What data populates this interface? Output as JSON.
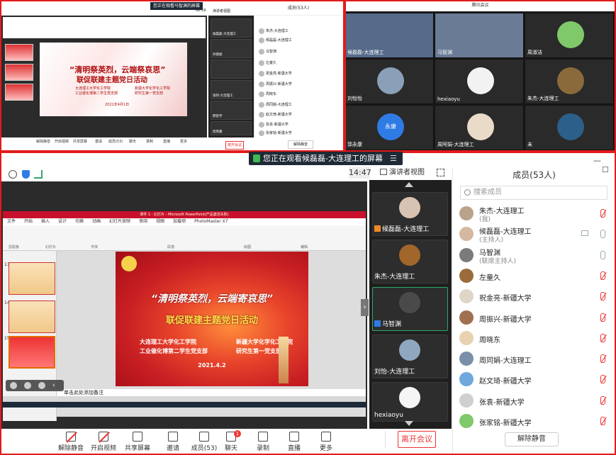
{
  "thumb": {
    "notice": "您正在观看马智渊的屏幕",
    "time": "00:59",
    "view": "演讲者视图",
    "members_header": "成员(53人)",
    "slide_title1": "“清明祭英烈，云端祭哀思”",
    "slide_title2": "联促联建主题党日活动",
    "slide_left": [
      "大连理工大学化工学院",
      "工业催化博第二学生党支部"
    ],
    "slide_right": [
      "新疆大学化学化工学院",
      "研究生第一党支部"
    ],
    "slide_date": "2021年4月1日",
    "videos": [
      "候磊磊-大连理工",
      "孙建斌",
      "",
      "张钊-大连理工",
      "邢智宇",
      "周厚康"
    ],
    "members": [
      "朱杰-大连理工",
      "候磊磊-大连理工",
      "马智渊",
      "左童久",
      "祝金亮-新疆大学",
      "周振兴-新疆大学",
      "周晓东",
      "周同娟-大连理工",
      "赵文琦-新疆大学",
      "张袁-新疆大学",
      "张家铭-新疆大学"
    ],
    "toolbar": [
      "解除静音",
      "开启视频",
      "共享屏幕",
      "邀请",
      "成员(53)",
      "聊天",
      "录制",
      "直播",
      "更多"
    ],
    "leave": "离开会议",
    "unmute": "解除静音"
  },
  "grid": {
    "title": "腾讯会议",
    "cells": [
      {
        "name": "候磊磊-大连理工",
        "host": true
      },
      {
        "name": "马智渊",
        "host": false
      },
      {
        "name": "周淑洁",
        "host": false
      },
      {
        "name": "刘怡怡",
        "host": false
      },
      {
        "name": "hexiaoyu",
        "host": false
      },
      {
        "name": "朱杰-大连理工",
        "host": false
      },
      {
        "name": "郭永康",
        "host": false
      },
      {
        "name": "周阿娟-大连理工",
        "host": false
      },
      {
        "name": "未",
        "host": false
      }
    ],
    "avatar_text": "永康"
  },
  "main": {
    "notice": "您正在观看候磊磊-大连理工的屏幕",
    "time": "14:47",
    "view": "演讲者视图",
    "ppt": {
      "window_title": "课件 1 - 幻灯片 - Microsoft PowerPoint(产品激活失败)",
      "tabs": [
        "文件",
        "开始",
        "插入",
        "设计",
        "切换",
        "动画",
        "幻灯片放映",
        "审阅",
        "视图",
        "加载项",
        "PhotoMaster X7"
      ],
      "groups": [
        "剪贴板",
        "幻灯片",
        "字体",
        "段落",
        "绘图",
        "编辑"
      ],
      "slide_numbers": [
        "13",
        "14",
        "15"
      ],
      "notes": "单击此处添加备注"
    },
    "slide": {
      "headline1": "“清明祭英烈，云端寄哀思”",
      "headline2": "联促联建主题党日活动",
      "left": [
        "大连理工大学化工学院",
        "工业催化博第二学生党支部"
      ],
      "right": [
        "新疆大学化学化工学院",
        "研究生第一党支部"
      ],
      "date": "2021.4.2"
    },
    "videos": [
      {
        "name": "候磊磊-大连理工",
        "badge": "host"
      },
      {
        "name": "朱杰-大连理工",
        "badge": ""
      },
      {
        "name": "马智渊",
        "badge": "me"
      },
      {
        "name": "刘怡-大连理工",
        "badge": ""
      },
      {
        "name": "hexiaoyu",
        "badge": ""
      }
    ],
    "members_header": "成员(53人)",
    "search_placeholder": "搜索成员",
    "members": [
      {
        "name": "朱杰-大连理工",
        "sub": "(我)",
        "mic": "off",
        "cam": false
      },
      {
        "name": "候磊磊-大连理工",
        "sub": "(主持人)",
        "mic": "on",
        "cam": true
      },
      {
        "name": "马智渊",
        "sub": "(联席主持人)",
        "mic": "on",
        "cam": false
      },
      {
        "name": "左童久",
        "sub": "",
        "mic": "off",
        "cam": false
      },
      {
        "name": "祝金亮-新疆大学",
        "sub": "",
        "mic": "off",
        "cam": false
      },
      {
        "name": "周振兴-新疆大学",
        "sub": "",
        "mic": "off",
        "cam": false
      },
      {
        "name": "周晓东",
        "sub": "",
        "mic": "off",
        "cam": false
      },
      {
        "name": "周同娟-大连理工",
        "sub": "",
        "mic": "off",
        "cam": false
      },
      {
        "name": "赵文琦-新疆大学",
        "sub": "",
        "mic": "off",
        "cam": false
      },
      {
        "name": "张袁-新疆大学",
        "sub": "",
        "mic": "off",
        "cam": false
      },
      {
        "name": "张家铭-新疆大学",
        "sub": "",
        "mic": "off",
        "cam": false
      }
    ],
    "toolbar": [
      {
        "label": "解除静音",
        "icon": "mic-muted-icon",
        "red": true
      },
      {
        "label": "开启视频",
        "icon": "camera-off-icon",
        "red": true
      },
      {
        "label": "共享屏幕",
        "icon": "share-screen-icon",
        "red": false
      },
      {
        "label": "邀请",
        "icon": "invite-icon",
        "red": false
      },
      {
        "label": "成员(53)",
        "icon": "members-icon",
        "red": false
      },
      {
        "label": "聊天",
        "icon": "chat-icon",
        "red": false,
        "badge": "1"
      },
      {
        "label": "录制",
        "icon": "record-icon",
        "red": false
      },
      {
        "label": "直播",
        "icon": "live-icon",
        "red": false
      },
      {
        "label": "更多",
        "icon": "more-icon",
        "red": false
      }
    ],
    "leave": "离开会议",
    "unmute_all": "解除静音"
  },
  "colors": {
    "accent_red": "#e21b1b",
    "host_orange": "#f08a24",
    "self_blue": "#2f7be6",
    "active_green": "#2fa86a"
  }
}
